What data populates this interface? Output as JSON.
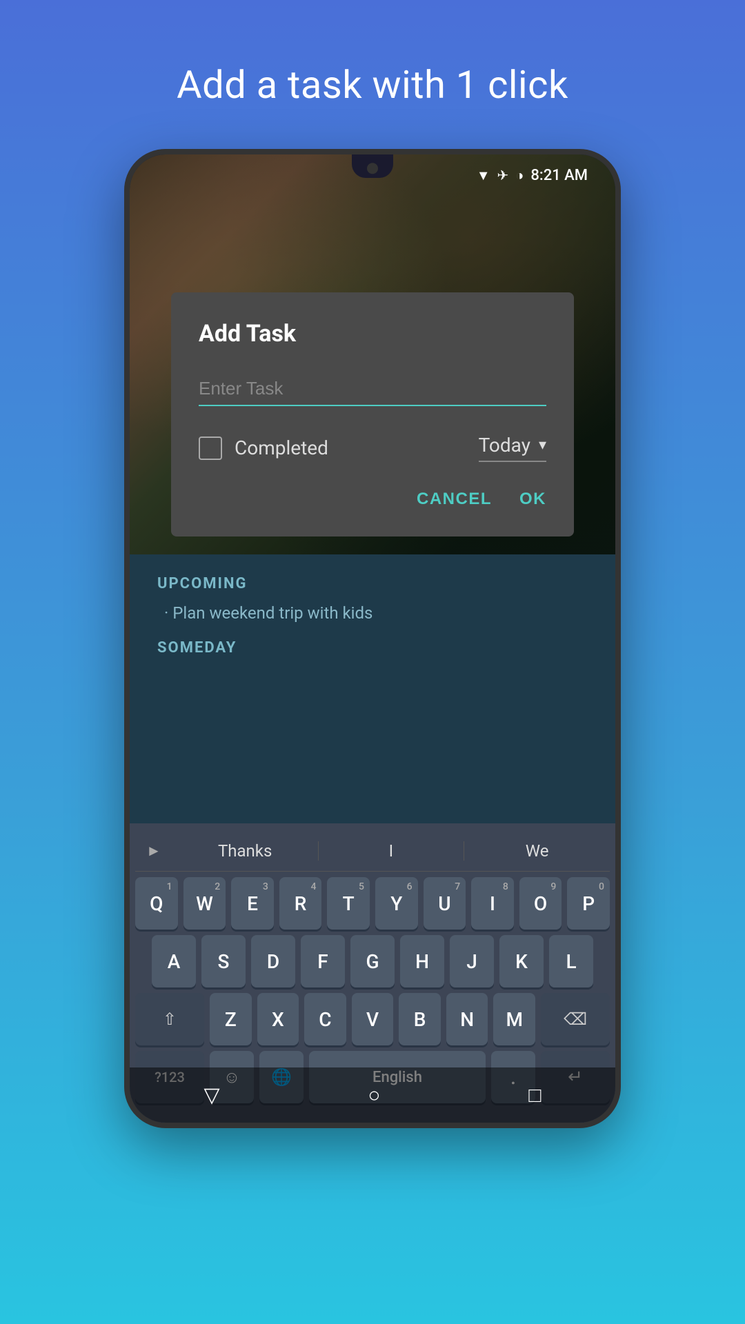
{
  "background": {
    "gradient_start": "#4a6fd8",
    "gradient_end": "#29c4e0"
  },
  "header": {
    "title": "Add a task with 1 click"
  },
  "phone": {
    "status_bar": {
      "time": "8:21 AM",
      "icons": [
        "wifi",
        "airplane",
        "alarm"
      ]
    }
  },
  "dialog": {
    "title": "Add Task",
    "input_placeholder": "Enter Task",
    "completed_label": "Completed",
    "date_label": "Today",
    "cancel_button": "CANCEL",
    "ok_button": "OK"
  },
  "app_content": {
    "section1": "UPCOMING",
    "task1": "Plan weekend trip with kids",
    "section2": "SOMEDAY"
  },
  "keyboard": {
    "suggestions": [
      "Thanks",
      "I",
      "We"
    ],
    "row1": [
      {
        "key": "Q",
        "num": "1"
      },
      {
        "key": "W",
        "num": "2"
      },
      {
        "key": "E",
        "num": "3"
      },
      {
        "key": "R",
        "num": "4"
      },
      {
        "key": "T",
        "num": "5"
      },
      {
        "key": "Y",
        "num": "6"
      },
      {
        "key": "U",
        "num": "7"
      },
      {
        "key": "I",
        "num": "8"
      },
      {
        "key": "O",
        "num": "9"
      },
      {
        "key": "P",
        "num": "0"
      }
    ],
    "row2": [
      "A",
      "S",
      "D",
      "F",
      "G",
      "H",
      "J",
      "K",
      "L"
    ],
    "row3": [
      "Z",
      "X",
      "C",
      "V",
      "B",
      "N",
      "M"
    ],
    "special_left": "?123",
    "emoji": "☺",
    "globe": "🌐",
    "space": "English",
    "period": ".",
    "enter": "↵"
  },
  "nav_bar": {
    "back": "▽",
    "home": "○",
    "recent": "□"
  }
}
